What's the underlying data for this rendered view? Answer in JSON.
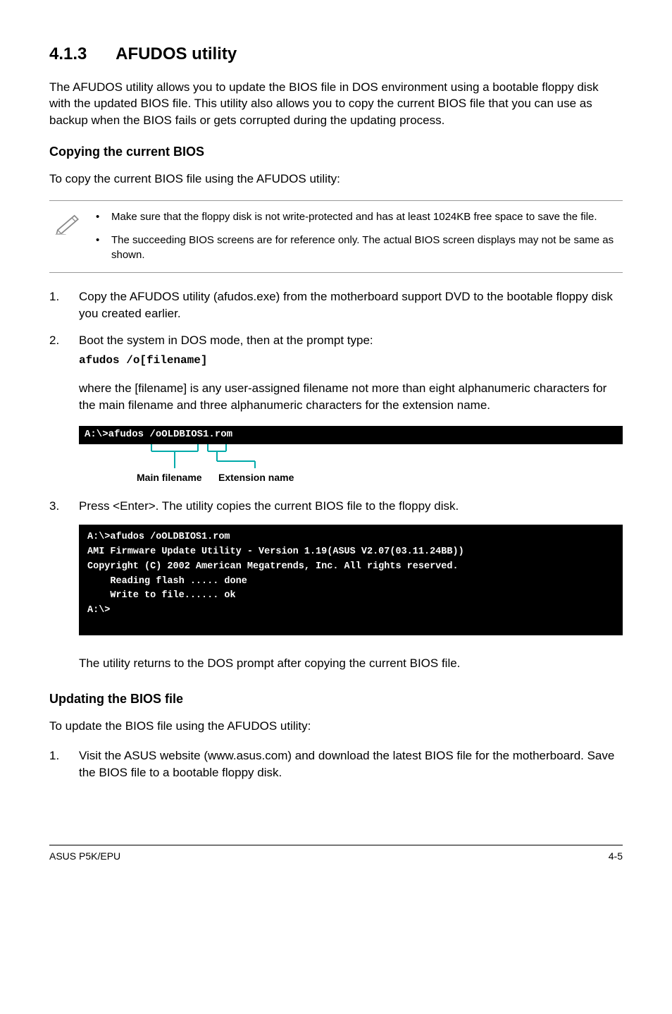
{
  "section": {
    "number": "4.1.3",
    "title": "AFUDOS utility"
  },
  "intro": "The AFUDOS utility allows you to update the BIOS file in DOS environment using a bootable floppy disk with the updated BIOS file. This utility also allows you to copy the current BIOS file that you can use as backup when the BIOS fails or gets corrupted during the updating process.",
  "copying": {
    "heading": "Copying the current BIOS",
    "lead": "To copy the current BIOS file using the AFUDOS utility:",
    "notes": [
      "Make sure that the floppy disk is not write-protected and has at least 1024KB free space to save the file.",
      "The succeeding BIOS screens are for reference only. The actual BIOS screen displays may not be same as shown."
    ],
    "steps": {
      "s1": {
        "num": "1.",
        "text": "Copy the AFUDOS utility (afudos.exe) from the motherboard support DVD to the bootable floppy disk you created earlier."
      },
      "s2": {
        "num": "2.",
        "text": "Boot the system in DOS mode, then at the prompt type:",
        "code": "afudos /o[filename]",
        "sub": "where the [filename] is any user-assigned filename not more than eight alphanumeric characters  for the main filename and three alphanumeric characters for the extension name."
      },
      "s3": {
        "num": "3.",
        "text": "Press <Enter>. The utility copies the current BIOS file to the floppy disk."
      }
    },
    "diagram": {
      "bar": "A:\\>afudos /oOLDBIOS1.rom",
      "label_main": "Main filename",
      "label_ext": "Extension name"
    },
    "terminal": "A:\\>afudos /oOLDBIOS1.rom\nAMI Firmware Update Utility - Version 1.19(ASUS V2.07(03.11.24BB))\nCopyright (C) 2002 American Megatrends, Inc. All rights reserved.\n    Reading flash ..... done\n    Write to file...... ok\nA:\\>",
    "outro": "The utility returns to the DOS prompt after copying the current BIOS file."
  },
  "updating": {
    "heading": "Updating the BIOS file",
    "lead": "To update the BIOS file using the AFUDOS utility:",
    "steps": {
      "s1": {
        "num": "1.",
        "text": "Visit the ASUS website (www.asus.com) and download the latest BIOS file for the motherboard. Save the BIOS file to a bootable floppy disk."
      }
    }
  },
  "footer": {
    "left": "ASUS P5K/EPU",
    "right": "4-5"
  }
}
